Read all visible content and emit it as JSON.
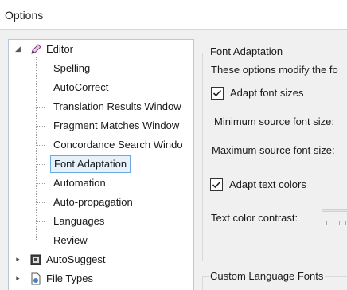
{
  "window": {
    "title": "Options"
  },
  "tree": {
    "root": {
      "label": "Editor",
      "icon": "pencil-icon"
    },
    "children": [
      {
        "label": "Spelling"
      },
      {
        "label": "AutoCorrect"
      },
      {
        "label": "Translation Results Window"
      },
      {
        "label": "Fragment Matches Window"
      },
      {
        "label": "Concordance Search Windo"
      },
      {
        "label": "Font Adaptation",
        "selected": true
      },
      {
        "label": "Automation"
      },
      {
        "label": "Auto-propagation"
      },
      {
        "label": "Languages"
      },
      {
        "label": "Review"
      }
    ],
    "siblings": [
      {
        "label": "AutoSuggest",
        "icon": "autosuggest-icon"
      },
      {
        "label": "File Types",
        "icon": "file-types-icon"
      }
    ]
  },
  "panel": {
    "group_title": "Font Adaptation",
    "description": "These options modify the fo",
    "adapt_font_sizes": {
      "label": "Adapt font sizes",
      "checked": true
    },
    "min_font_label": "Minimum source font size:",
    "max_font_label": "Maximum source font size:",
    "adapt_text_colors": {
      "label": "Adapt text colors",
      "checked": true
    },
    "contrast_label": "Text color contrast:",
    "custom_fonts_title": "Custom Language Fonts"
  },
  "colors": {
    "selection_bg": "#e5f1fb",
    "selection_border": "#6fa8dc",
    "tree_border": "#b9c7d6"
  }
}
